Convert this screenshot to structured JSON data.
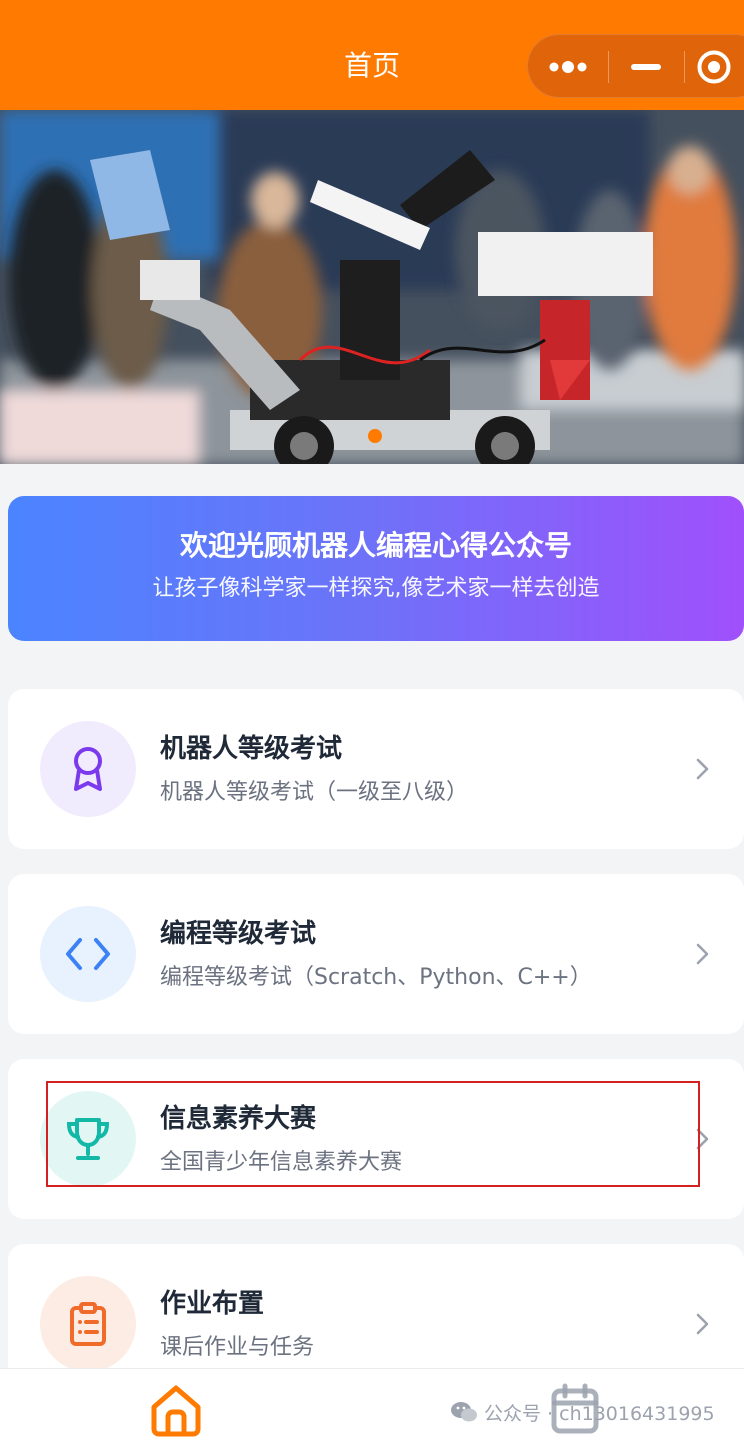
{
  "navbar": {
    "title": "首页",
    "background": "#ff7a00",
    "capsule_icons": [
      "more-dots-icon",
      "minimize-icon",
      "target-close-icon"
    ]
  },
  "hero": {
    "image_description_icon": "robot-photo-banner"
  },
  "welcome": {
    "title": "欢迎光顾机器人编程心得公众号",
    "subtitle": "让孩子像科学家一样探究,像艺术家一样去创造",
    "gradient": [
      "#4b84ff",
      "#a050fb"
    ]
  },
  "menu": [
    {
      "title": "机器人等级考试",
      "subtitle": "机器人等级考试（一级至八级）",
      "icon": "award-ribbon-icon",
      "icon_color": "#7c3aed",
      "icon_bg": "#f1ecfd"
    },
    {
      "title": "编程等级考试",
      "subtitle": "编程等级考试（Scratch、Python、C++）",
      "icon": "code-brackets-icon",
      "icon_color": "#3b82f6",
      "icon_bg": "#e8f1fe"
    },
    {
      "title": "信息素养大赛",
      "subtitle": "全国青少年信息素养大赛",
      "icon": "trophy-icon",
      "icon_color": "#14b8a6",
      "icon_bg": "#e2f7f4"
    },
    {
      "title": "作业布置",
      "subtitle": "课后作业与任务",
      "icon": "clipboard-list-icon",
      "icon_color": "#f06a2a",
      "icon_bg": "#fdece4"
    }
  ],
  "tabbar": {
    "home_icon": "home-icon",
    "home_color": "#ff7a00",
    "calendar_icon": "calendar-icon"
  },
  "watermark": {
    "text": "公众号 · ch13016431995",
    "icon": "wechat-icon"
  }
}
